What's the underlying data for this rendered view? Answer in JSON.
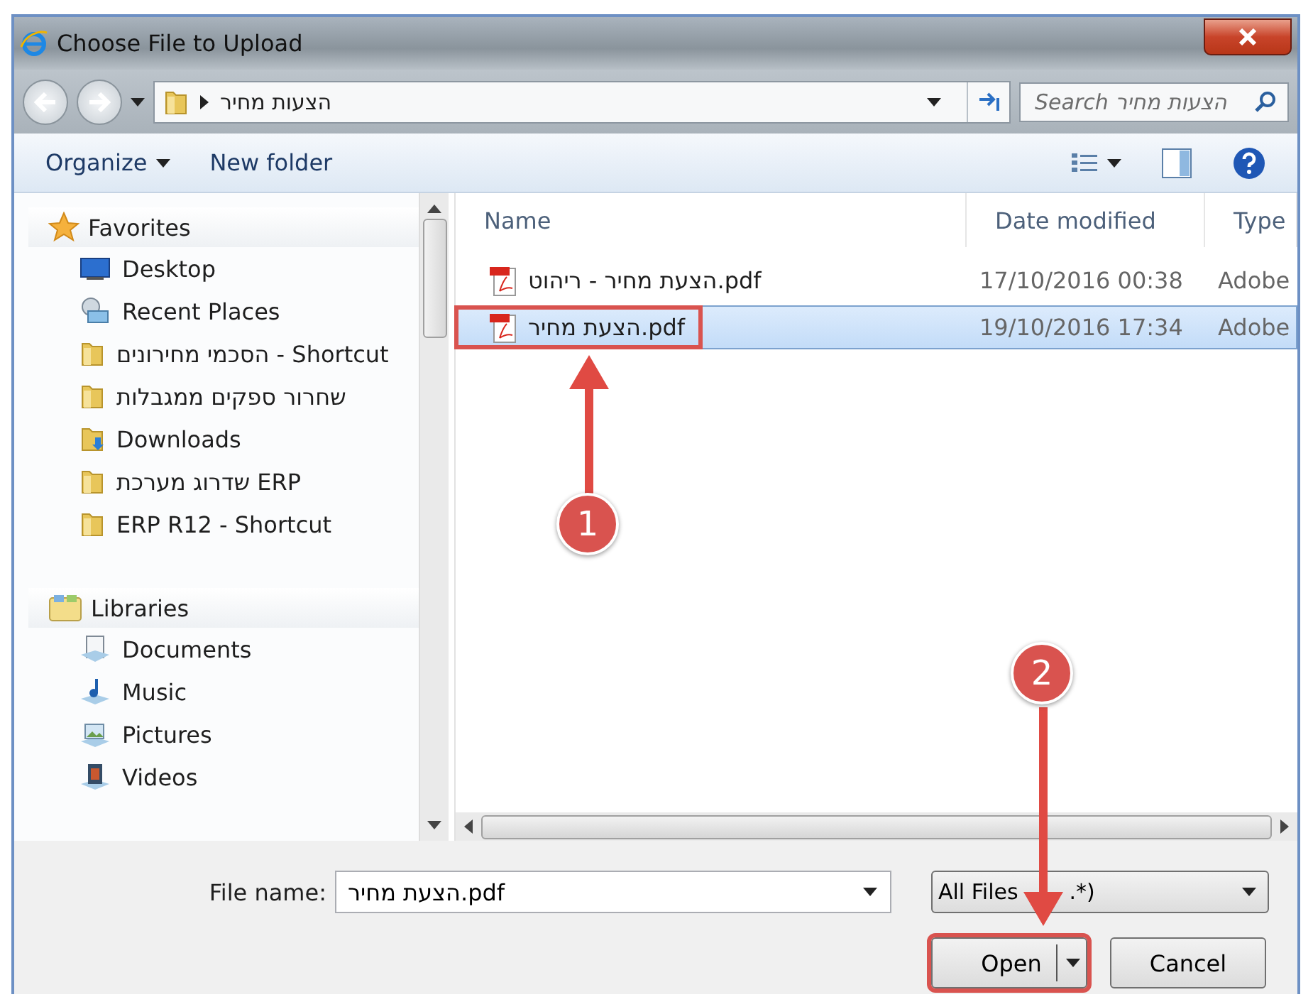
{
  "window": {
    "title": "Choose File to Upload"
  },
  "address": {
    "path": "הצעות מחיר",
    "search_placeholder": "Search הצעות מחיר"
  },
  "toolbar": {
    "items": [
      {
        "label": "Organize",
        "menu": true
      },
      {
        "label": "New folder",
        "menu": false
      }
    ]
  },
  "sidebar": {
    "groups": [
      {
        "label": "Favorites",
        "kind": "favorites",
        "children": [
          {
            "label": "Desktop",
            "kind": "desktop"
          },
          {
            "label": "Recent Places",
            "kind": "recent"
          },
          {
            "label": "הסכמי מחירונים - Shortcut",
            "kind": "folder"
          },
          {
            "label": "שחרור ספקים ממגבלות",
            "kind": "folder"
          },
          {
            "label": "Downloads",
            "kind": "downloads"
          },
          {
            "label": "שדרוג מערכת ERP",
            "kind": "folder"
          },
          {
            "label": "ERP R12 - Shortcut",
            "kind": "folder"
          }
        ]
      },
      {
        "label": "Libraries",
        "kind": "libraries",
        "children": [
          {
            "label": "Documents",
            "kind": "documents"
          },
          {
            "label": "Music",
            "kind": "music"
          },
          {
            "label": "Pictures",
            "kind": "pictures"
          },
          {
            "label": "Videos",
            "kind": "videos"
          }
        ]
      }
    ]
  },
  "file_list": {
    "columns": [
      "Name",
      "Date modified",
      "Type"
    ],
    "rows": [
      {
        "name": "הצעת מחיר - ריהוט.pdf",
        "date": "17/10/2016 00:38",
        "type": "Adobe",
        "selected": false
      },
      {
        "name": "הצעת מחיר.pdf",
        "date": "19/10/2016 17:34",
        "type": "Adobe",
        "selected": true
      }
    ]
  },
  "file_name": {
    "label": "File name:",
    "value": "הצעת מחיר.pdf"
  },
  "file_type": {
    "text": "All Files",
    "tail": ".*)"
  },
  "buttons": [
    {
      "label": "Open",
      "kind": "split"
    },
    {
      "label": "Cancel",
      "kind": "plain"
    }
  ],
  "annotations": [
    {
      "number": "1"
    },
    {
      "number": "2"
    }
  ]
}
